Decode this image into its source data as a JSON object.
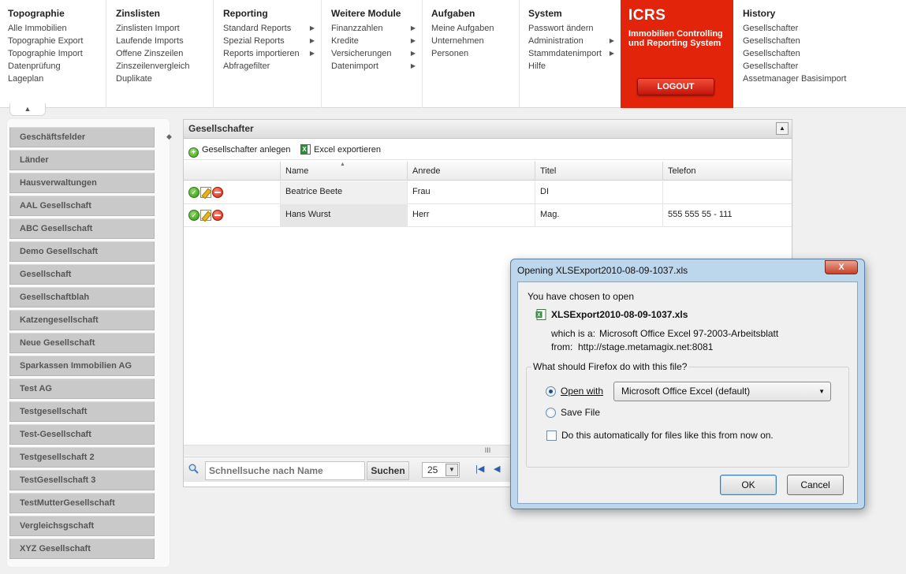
{
  "menu": {
    "topographie": {
      "title": "Topographie",
      "items": [
        "Alle Immobilien",
        "Topographie Export",
        "Topographie Import",
        "Datenprüfung",
        "Lageplan"
      ]
    },
    "zinslisten": {
      "title": "Zinslisten",
      "items": [
        "Zinslisten Import",
        "Laufende Imports",
        "Offene Zinszeilen",
        "Zinszeilenvergleich",
        "Duplikate"
      ]
    },
    "reporting": {
      "title": "Reporting",
      "items": [
        "Standard Reports",
        "Spezial Reports",
        "Reports importieren",
        "Abfragefilter"
      ]
    },
    "weitere": {
      "title": "Weitere Module",
      "items": [
        "Finanzzahlen",
        "Kredite",
        "Versicherungen",
        "Datenimport"
      ]
    },
    "aufgaben": {
      "title": "Aufgaben",
      "items": [
        "Meine Aufgaben",
        "Unternehmen",
        "Personen"
      ]
    },
    "system": {
      "title": "System",
      "items": [
        "Passwort ändern",
        "Administration",
        "Stammdatenimport",
        "Hilfe"
      ]
    },
    "history": {
      "title": "History",
      "items": [
        "Gesellschafter",
        "Gesellschaften",
        "Gesellschaften",
        "Gesellschafter",
        "Assetmanager Basisimport"
      ]
    }
  },
  "brand": {
    "logo": "ICRS",
    "subtitle_line1": "Immobilien Controlling",
    "subtitle_line2": "und Reporting System",
    "logout": "LOGOUT",
    "color": "#e2240b"
  },
  "sidebar": {
    "items": [
      "Geschäftsfelder",
      "Länder",
      "Hausverwaltungen",
      "AAL Gesellschaft",
      "ABC Gesellschaft",
      "Demo Gesellschaft",
      "Gesellschaft",
      "Gesellschaftblah",
      "Katzengesellschaft",
      "Neue Gesellschaft",
      "Sparkassen Immobilien AG",
      "Test AG",
      "Testgesellschaft",
      "Test-Gesellschaft",
      "Testgesellschaft 2",
      "TestGesellschaft 3",
      "TestMutterGesellschaft",
      "Vergleichsgschaft",
      "XYZ Gesellschaft"
    ]
  },
  "panel": {
    "title": "Gesellschafter",
    "add_label": "Gesellschafter anlegen",
    "export_label": "Excel exportieren",
    "columns": [
      "Name",
      "Anrede",
      "Titel",
      "Telefon"
    ],
    "rows": [
      {
        "name": "Beatrice Beete",
        "anrede": "Frau",
        "titel": "DI",
        "telefon": ""
      },
      {
        "name": "Hans Wurst",
        "anrede": "Herr",
        "titel": "Mag.",
        "telefon": "555 555 55 - 111"
      }
    ],
    "scroll_grip": "III",
    "search_placeholder": "Schnellsuche nach Name",
    "search_button": "Suchen",
    "page_size": "25"
  },
  "dialog": {
    "title": "Opening XLSExport2010-08-09-1037.xls",
    "close": "X",
    "intro": "You have chosen to open",
    "filename": "XLSExport2010-08-09-1037.xls",
    "which_label": "which is a:",
    "which_value": "Microsoft Office Excel 97-2003-Arbeitsblatt",
    "from_label": "from:",
    "from_value": "http://stage.metamagix.net:8081",
    "question": "What should Firefox do with this file?",
    "open_with": "Open with",
    "app": "Microsoft Office Excel (default)",
    "save_file": "Save File",
    "auto_label": "Do this automatically for files like this from now on.",
    "ok": "OK",
    "cancel": "Cancel"
  }
}
